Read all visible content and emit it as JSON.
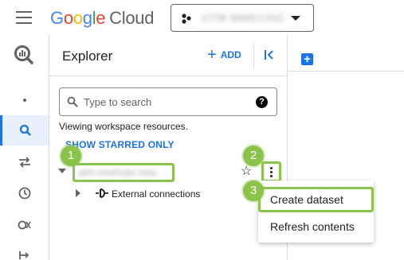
{
  "app": {
    "logo_google": [
      "G",
      "o",
      "o",
      "g",
      "l",
      "e"
    ],
    "logo_cloud": "Cloud",
    "project_picker": {
      "name": "UTM-MMKCINC"
    }
  },
  "icons": {
    "hamburger": "menu-icon",
    "bigquery": "bigquery-logo-icon",
    "add": "plus-icon",
    "collapse": "collapse-panel-icon",
    "search": "search-icon",
    "help": "help-icon",
    "star": "star-outline-icon",
    "more": "more-vert-icon",
    "external": "external-connection-icon",
    "new_tab": "add-tab-icon"
  },
  "left_rail": {
    "items": [
      {
        "name": "overview",
        "icon": "dot-icon"
      },
      {
        "name": "search",
        "icon": "search-icon",
        "active": true
      },
      {
        "name": "data-transfers",
        "icon": "transfer-icon"
      },
      {
        "name": "scheduled-queries",
        "icon": "clock-icon"
      },
      {
        "name": "analytics-hub",
        "icon": "hub-icon"
      },
      {
        "name": "dataflow",
        "icon": "pipeline-icon"
      }
    ]
  },
  "explorer": {
    "title": "Explorer",
    "add_label": "ADD",
    "search_placeholder": "Type to search",
    "help_glyph": "?",
    "viewing_text": "Viewing workspace resources.",
    "starred_link": "SHOW STARRED ONLY",
    "tree": {
      "project": "ptm-morfrubs reex",
      "children": [
        {
          "label": "External connections"
        }
      ]
    }
  },
  "context_menu": {
    "items": [
      {
        "label": "Create dataset",
        "highlighted": true
      },
      {
        "label": "Refresh contents",
        "highlighted": false
      }
    ]
  },
  "annotations": {
    "steps": [
      "1",
      "2",
      "3"
    ],
    "highlight_color": "#8bc34a"
  },
  "colors": {
    "accent": "#1a73e8",
    "text": "#202124",
    "muted": "#5f6368",
    "divider": "#dadce0",
    "active_bg": "#e8f0fe"
  }
}
